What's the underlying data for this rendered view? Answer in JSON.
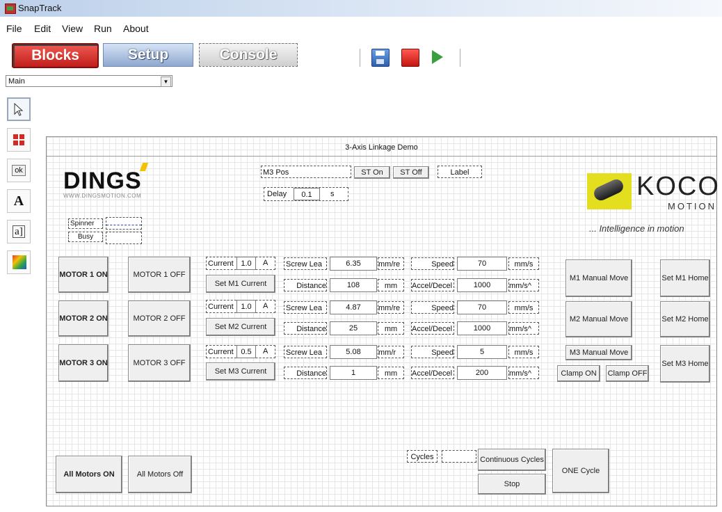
{
  "window": {
    "title": "SnapTrack"
  },
  "menu": [
    "File",
    "Edit",
    "View",
    "Run",
    "About"
  ],
  "tabs": {
    "blocks": "Blocks",
    "setup": "Setup",
    "console": "Console"
  },
  "toolbar": {
    "save_icon": "save-icon",
    "stop_icon": "stop-icon",
    "run_icon": "play-icon"
  },
  "view_select": {
    "value": "Main"
  },
  "palette_tools": [
    "pointer-icon",
    "add-button-icon",
    "ok-button-icon",
    "text-label-icon",
    "text-field-icon",
    "color-image-icon"
  ],
  "palette_labels": {
    "ok": "ok",
    "text": "A",
    "field": "a]"
  },
  "canvas": {
    "title": "3-Axis Linkage Demo",
    "m3pos_label": "M3 Pos",
    "st_on": "ST On",
    "st_off": "ST Off",
    "label_text": "Label",
    "delay_label": "Delay",
    "delay_value": "0.1",
    "delay_unit": "s",
    "spinner": "Spinner",
    "busy": "Busy",
    "logo_left": "DINGS",
    "logo_left_url": "WWW.DINGSMOTION.COM",
    "logo_right": "KOCO",
    "logo_right_sub": "MOTION",
    "logo_right_tag": "... Intelligence in motion",
    "motors": [
      {
        "on": "MOTOR 1 ON",
        "off": "MOTOR 1 OFF",
        "current_label": "Current",
        "current": "1.0",
        "current_unit": "A",
        "set_current": "Set M1 Current",
        "lead_label": "Screw Lea",
        "lead": "6.35",
        "lead_unit": "mm/re",
        "distance_label": "Distance",
        "distance": "108",
        "distance_unit": "mm",
        "speed_label": "Speed",
        "speed": "70",
        "speed_unit": "mm/s",
        "accel_label": "Accel/Decel",
        "accel": "1000",
        "accel_unit": "mm/s^",
        "manual": "M1 Manual Move",
        "home": "Set M1 Home"
      },
      {
        "on": "MOTOR 2 ON",
        "off": "MOTOR 2 OFF",
        "current_label": "Current",
        "current": "1.0",
        "current_unit": "A",
        "set_current": "Set M2 Current",
        "lead_label": "Screw Lea",
        "lead": "4.87",
        "lead_unit": "mm/re",
        "distance_label": "Distance",
        "distance": "25",
        "distance_unit": "mm",
        "speed_label": "Speed",
        "speed": "70",
        "speed_unit": "mm/s",
        "accel_label": "Accel/Decel",
        "accel": "1000",
        "accel_unit": "mm/s^",
        "manual": "M2 Manual Move",
        "home": "Set M2 Home"
      },
      {
        "on": "MOTOR 3 ON",
        "off": "MOTOR 3 OFF",
        "current_label": "Current",
        "current": "0.5",
        "current_unit": "A",
        "set_current": "Set M3 Current",
        "lead_label": "Screw Lea",
        "lead": "5.08",
        "lead_unit": "mm/r",
        "distance_label": "Distance",
        "distance": "1",
        "distance_unit": "mm",
        "speed_label": "Speed",
        "speed": "5",
        "speed_unit": "mm/s",
        "accel_label": "Accel/Decel",
        "accel": "200",
        "accel_unit": "mm/s^",
        "manual": "M3 Manual Move",
        "home": "Set M3 Home"
      }
    ],
    "clamp_on": "Clamp ON",
    "clamp_off": "Clamp OFF",
    "all_on": "All Motors ON",
    "all_off": "All Motors Off",
    "cycles_label": "Cycles",
    "continuous": "Continuous Cycles",
    "stop": "Stop",
    "one_cycle": "ONE Cycle"
  }
}
